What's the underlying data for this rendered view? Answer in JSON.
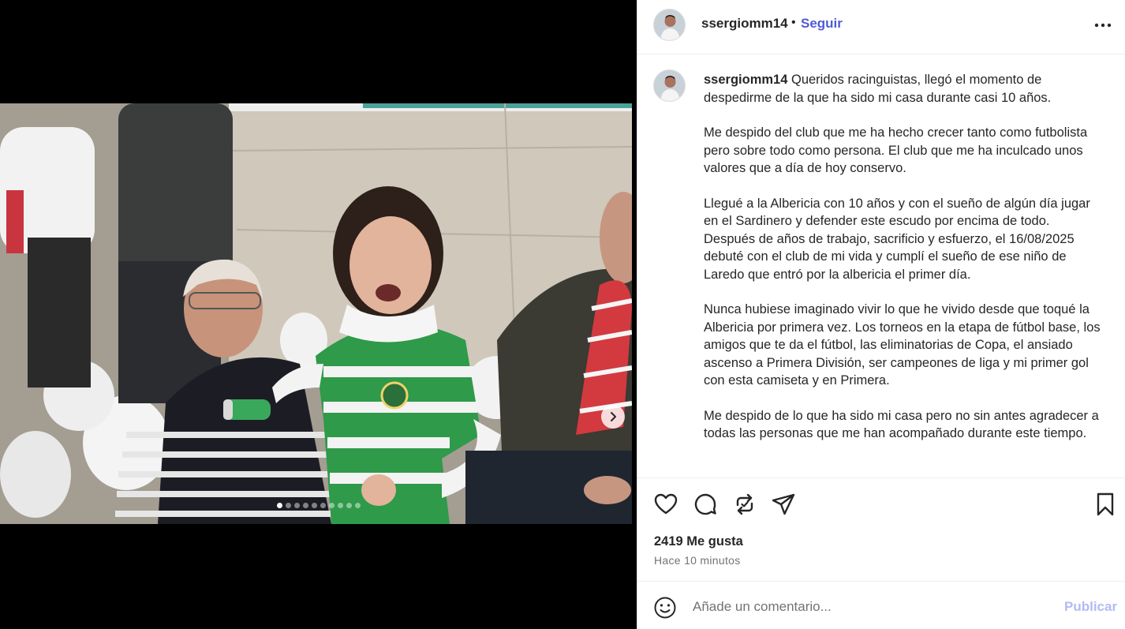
{
  "post": {
    "username": "ssergiomm14",
    "separator": "•",
    "follow_label": "Seguir",
    "more_icon": "more-horizontal-icon",
    "carousel": {
      "slides": 10,
      "active_index": 0
    }
  },
  "caption": {
    "username": "ssergiomm14",
    "paragraphs": [
      [
        "Queridos racinguistas, llegó el momento de despedirme de la que ha sido mi casa durante casi 10 años."
      ],
      [
        "Me despido del club que me ha hecho crecer tanto como futbolista pero sobre todo como persona. El club que me ha inculcado unos valores que a día de hoy conservo."
      ],
      [
        "Llegué a la Albericia con 10 años y con el sueño de algún día jugar en el Sardinero y defender este escudo por encima de todo.",
        "Después de años de trabajo, sacrificio y esfuerzo, el 16/08/2025 debuté con el club de mi vida y cumplí el sueño de ese niño de Laredo que entró por la albericia el primer día."
      ],
      [
        "Nunca hubiese imaginado vivir lo que he vivido desde que toqué la Albericia por primera vez. Los torneos en la etapa de fútbol base, los amigos que te da el fútbol, las eliminatorias de Copa, el ansiado ascenso a Primera División, ser campeones de liga y mi primer gol con esta camiseta y en Primera."
      ],
      [
        "Me despido de lo que ha sido mi casa pero no sin antes agradecer a todas las personas que me han acompañado durante este tiempo."
      ]
    ]
  },
  "stats": {
    "likes": "2419 Me gusta",
    "timestamp": "Hace 10 minutos"
  },
  "composer": {
    "placeholder": "Añade un comentario...",
    "publish_label": "Publicar"
  },
  "colors": {
    "accent": "#4f5bd5",
    "publish_disabled": "#b3bbf3",
    "text": "#262626",
    "muted": "#737373"
  }
}
